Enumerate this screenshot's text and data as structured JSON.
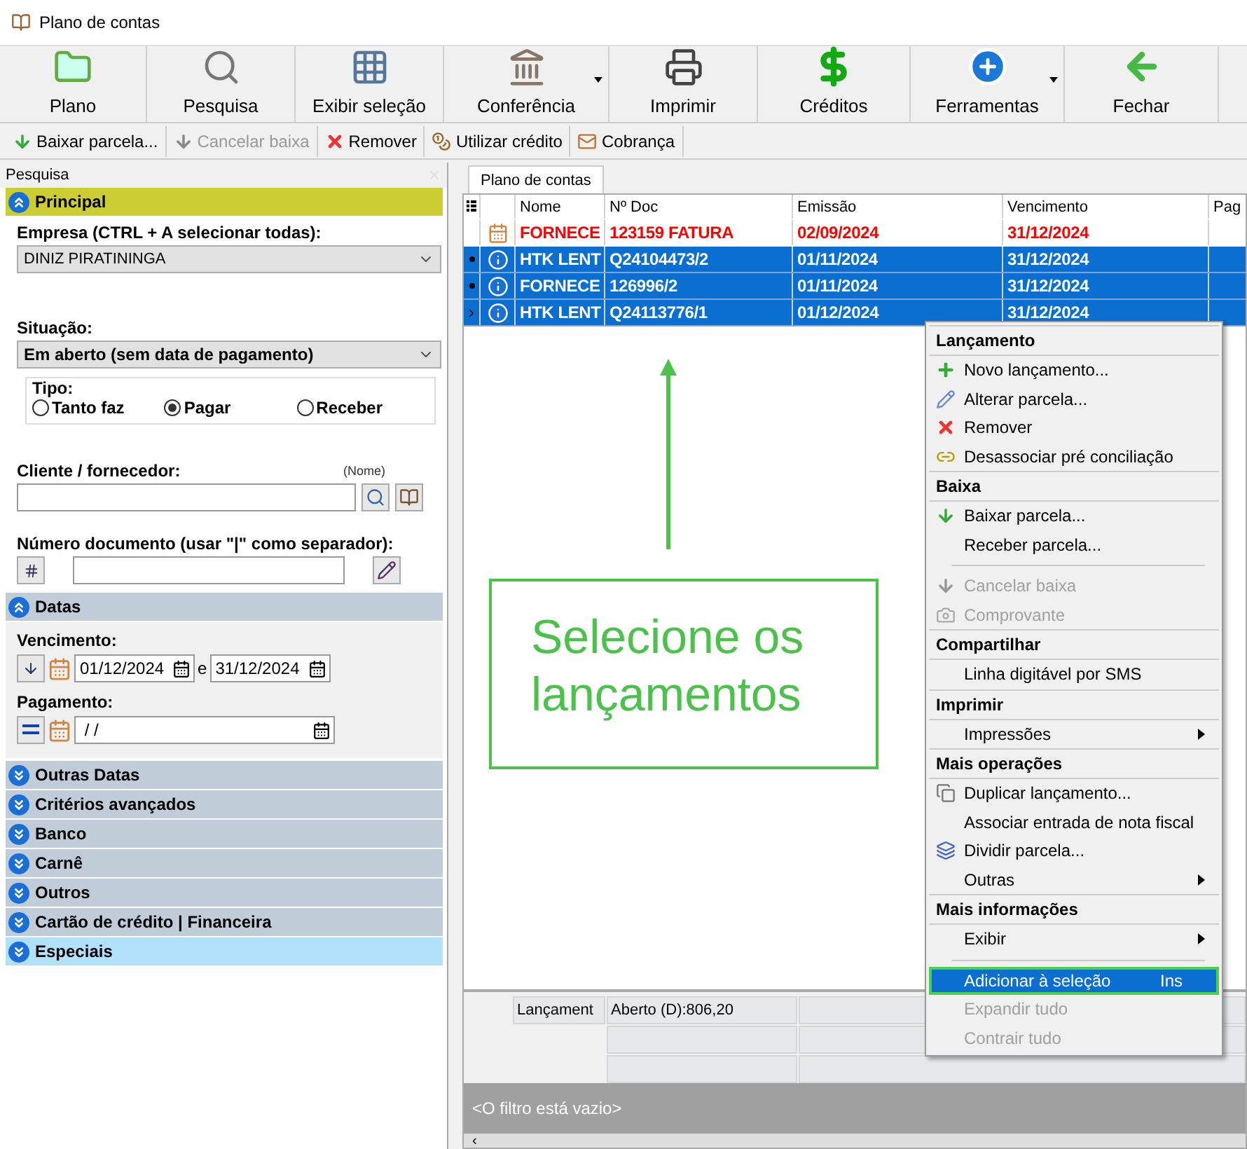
{
  "window": {
    "title": "Plano de contas"
  },
  "toolbar": [
    {
      "label": "Plano",
      "dropdown": false
    },
    {
      "label": "Pesquisa",
      "dropdown": false
    },
    {
      "label": "Exibir seleção",
      "dropdown": false
    },
    {
      "label": "Conferência",
      "dropdown": true
    },
    {
      "label": "Imprimir",
      "dropdown": false
    },
    {
      "label": "Créditos",
      "dropdown": false
    },
    {
      "label": "Ferramentas",
      "dropdown": true
    },
    {
      "label": "Fechar",
      "dropdown": false
    }
  ],
  "actions": [
    {
      "label": "Baixar parcela...",
      "disabled": false
    },
    {
      "label": "Cancelar baixa",
      "disabled": true
    },
    {
      "label": "Remover",
      "disabled": false
    },
    {
      "label": "Utilizar crédito",
      "disabled": false
    },
    {
      "label": "Cobrança",
      "disabled": false
    }
  ],
  "search_panel": {
    "title": "Pesquisa",
    "sections": [
      {
        "title": "Principal",
        "kind": "principal",
        "expanded": true,
        "selected": true,
        "hovered": false
      },
      {
        "title": "Datas",
        "kind": "datas",
        "expanded": true,
        "selected": false,
        "hovered": false
      },
      {
        "title": "Outras Datas",
        "expanded": false,
        "selected": false,
        "hovered": false
      },
      {
        "title": "Critérios avançados",
        "expanded": false,
        "selected": false,
        "hovered": false
      },
      {
        "title": "Banco",
        "expanded": false,
        "selected": false,
        "hovered": false
      },
      {
        "title": "Carnê",
        "expanded": false,
        "selected": false,
        "hovered": false
      },
      {
        "title": "Outros",
        "expanded": false,
        "selected": false,
        "hovered": false
      },
      {
        "title": "Cartão de crédito | Financeira",
        "expanded": false,
        "selected": false,
        "hovered": false
      },
      {
        "title": "Especiais",
        "expanded": false,
        "selected": false,
        "hovered": true
      }
    ],
    "principal": {
      "empresa_label": "Empresa (CTRL + A selecionar todas):",
      "empresa_value": "DINIZ PIRATININGA",
      "situacao_label": "Situação:",
      "situacao_value": "Em aberto (sem data de pagamento)",
      "tipo_label": "Tipo:",
      "tipo_options": [
        {
          "label": "Tanto faz",
          "selected": false
        },
        {
          "label": "Pagar",
          "selected": true
        },
        {
          "label": "Receber",
          "selected": false
        }
      ],
      "cliente_label": "Cliente / fornecedor:",
      "cliente_hint": "(Nome)",
      "documento_label": "Número documento (usar \"|\" como separador):"
    },
    "datas": {
      "vencimento_label": "Vencimento:",
      "vencimento_from": "01/12/2024",
      "vencimento_joiner": "e",
      "vencimento_to": "31/12/2024",
      "pagamento_label": "Pagamento:",
      "pagamento_value": " / /"
    }
  },
  "tab": {
    "label": "Plano de contas",
    "selected": true
  },
  "table": {
    "columns": [
      "Nome",
      "Nº Doc",
      "Emissão",
      "Vencimento",
      "Pag"
    ],
    "rows": [
      {
        "kind": "calendar",
        "overdue": true,
        "selected": false,
        "current": false,
        "cells": [
          "FORNECE",
          "123159 FATURA",
          "02/09/2024",
          "31/12/2024"
        ]
      },
      {
        "kind": "info",
        "overdue": false,
        "selected": true,
        "current": false,
        "cells": [
          "HTK LENT",
          "Q24104473/2",
          "01/11/2024",
          "31/12/2024"
        ]
      },
      {
        "kind": "info",
        "overdue": false,
        "selected": true,
        "current": false,
        "cells": [
          "FORNECE",
          "126996/2",
          "01/11/2024",
          "31/12/2024"
        ]
      },
      {
        "kind": "info",
        "overdue": false,
        "selected": true,
        "current": true,
        "cells": [
          "HTK LENT",
          "Q24113776/1",
          "01/12/2024",
          "31/12/2024"
        ]
      }
    ]
  },
  "summary": {
    "label": "Lançament",
    "value": "Aberto (D):806,20"
  },
  "filter_bar": {
    "text": "<O filtro está vazio>"
  },
  "scrollbar": {
    "arrow": "‹"
  },
  "context_menu": [
    {
      "kind": "header",
      "label": "Lançamento"
    },
    {
      "kind": "item",
      "label": "Novo lançamento...",
      "disabled": false,
      "selected": false
    },
    {
      "kind": "item",
      "label": "Alterar parcela...",
      "disabled": false,
      "selected": false
    },
    {
      "kind": "item",
      "label": "Remover",
      "disabled": false,
      "selected": false
    },
    {
      "kind": "item",
      "label": "Desassociar pré conciliação",
      "disabled": false,
      "selected": false
    },
    {
      "kind": "header",
      "label": "Baixa"
    },
    {
      "kind": "item",
      "label": "Baixar parcela...",
      "disabled": false,
      "selected": false
    },
    {
      "kind": "item",
      "label": "Receber parcela...",
      "disabled": false,
      "selected": false
    },
    {
      "kind": "separator"
    },
    {
      "kind": "item",
      "label": "Cancelar baixa",
      "disabled": true,
      "selected": false
    },
    {
      "kind": "item",
      "label": "Comprovante",
      "disabled": true,
      "selected": false
    },
    {
      "kind": "header",
      "label": "Compartilhar"
    },
    {
      "kind": "item",
      "label": "Linha digitável por SMS",
      "disabled": false,
      "selected": false
    },
    {
      "kind": "header",
      "label": "Imprimir"
    },
    {
      "kind": "submenu",
      "label": "Impressões",
      "disabled": false,
      "selected": false
    },
    {
      "kind": "header",
      "label": "Mais operações"
    },
    {
      "kind": "item",
      "label": "Duplicar lançamento...",
      "disabled": false,
      "selected": false
    },
    {
      "kind": "item",
      "label": "Associar entrada de nota fiscal",
      "disabled": false,
      "selected": false
    },
    {
      "kind": "item",
      "label": "Dividir parcela...",
      "disabled": false,
      "selected": false
    },
    {
      "kind": "submenu",
      "label": "Outras",
      "disabled": false,
      "selected": false
    },
    {
      "kind": "header",
      "label": "Mais informações"
    },
    {
      "kind": "submenu",
      "label": "Exibir",
      "disabled": false,
      "selected": false
    },
    {
      "kind": "separator"
    },
    {
      "kind": "item",
      "label": "Adicionar à seleção",
      "shortcut": "Ins",
      "disabled": false,
      "selected": true
    },
    {
      "kind": "item",
      "label": "Expandir tudo",
      "disabled": true,
      "selected": false
    },
    {
      "kind": "item",
      "label": "Contrair tudo",
      "disabled": true,
      "selected": false
    }
  ],
  "annotation": {
    "text": "Selecione os lançamentos"
  }
}
